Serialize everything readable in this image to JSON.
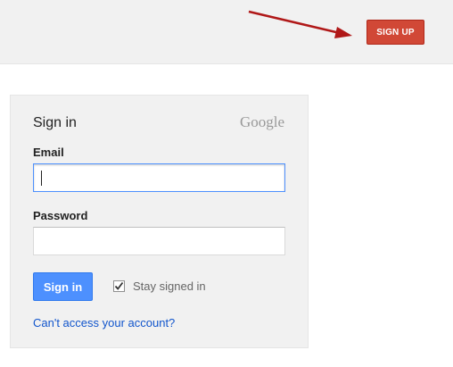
{
  "header": {
    "signup_label": "SIGN UP"
  },
  "signin_card": {
    "title": "Sign in",
    "logo_text": "Google",
    "email_label": "Email",
    "email_value": "",
    "password_label": "Password",
    "password_value": "",
    "signin_button_label": "Sign in",
    "stay_signed_in_label": "Stay signed in",
    "stay_signed_in_checked": true,
    "help_link_label": "Can't access your account?"
  },
  "colors": {
    "signup_red": "#d14836",
    "signin_blue": "#4d90fe",
    "link_blue": "#1155cc",
    "annotation_arrow": "#b01818"
  },
  "icons": [
    "annotation-arrow",
    "checkmark-icon"
  ]
}
